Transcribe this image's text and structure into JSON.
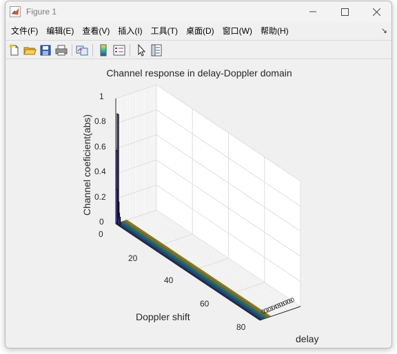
{
  "window": {
    "title": "Figure 1",
    "minimize_glyph": "—",
    "maximize_glyph": "☐",
    "close_glyph": "✕"
  },
  "menu": {
    "items": [
      "文件(F)",
      "编辑(E)",
      "查看(V)",
      "插入(I)",
      "工具(T)",
      "桌面(D)",
      "窗口(W)",
      "帮助(H)"
    ],
    "overflow_glyph": "↘"
  },
  "toolbar": {
    "icons": [
      "new-figure-icon",
      "open-file-icon",
      "save-icon",
      "print-icon",
      "link-plot-icon",
      "colorbar-icon",
      "legend-icon",
      "pointer-icon",
      "property-inspector-icon"
    ]
  },
  "chart_data": {
    "type": "bar3",
    "title": "Channel response in delay-Doppler domain",
    "xlabel": "Doppler shift",
    "ylabel": "delay",
    "zlabel": "Channel coeficient(abs)",
    "z_ticks": [
      "0",
      "0.2",
      "0.4",
      "0.6",
      "0.8",
      "1"
    ],
    "doppler_ticks": [
      "0",
      "20",
      "40",
      "60",
      "80"
    ],
    "delay_ticks_text": "0.020304050607080",
    "doppler_range": [
      0,
      80
    ],
    "delay_range": [
      0,
      80
    ],
    "zlim": [
      0,
      1
    ],
    "colormap": "parula",
    "peaks": [
      {
        "doppler": 0,
        "delay": 2,
        "value": 0.27
      },
      {
        "doppler": 0,
        "delay": 3,
        "value": 0.58
      },
      {
        "doppler": 0,
        "delay": 4,
        "value": 0.87
      },
      {
        "doppler": 0,
        "delay": 5,
        "value": 0.17
      },
      {
        "doppler": 0,
        "delay": 6,
        "value": 0.08
      },
      {
        "doppler": 1,
        "delay": 3,
        "value": 0.05
      },
      {
        "doppler": 1,
        "delay": 4,
        "value": 0.06
      }
    ],
    "background_value": 0,
    "grid": true
  }
}
